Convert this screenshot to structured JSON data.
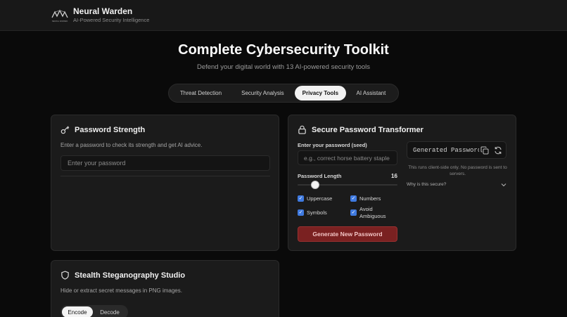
{
  "brand": {
    "name": "Neural Warden",
    "tagline": "AI-Powered Security Intelligence",
    "logo_text": "NEURAL WARDEN"
  },
  "hero": {
    "title": "Complete Cybersecurity Toolkit",
    "subtitle": "Defend your digital world with 13 AI-powered security tools"
  },
  "tabs": [
    {
      "label": "Threat Detection",
      "active": false
    },
    {
      "label": "Security Analysis",
      "active": false
    },
    {
      "label": "Privacy Tools",
      "active": true
    },
    {
      "label": "AI Assistant",
      "active": false
    }
  ],
  "password_strength": {
    "title": "Password Strength",
    "description": "Enter a password to check its strength and get AI advice.",
    "input_placeholder": "Enter your password",
    "icon": "key-icon"
  },
  "transformer": {
    "title": "Secure Password Transformer",
    "icon": "lock-icon",
    "seed_label": "Enter your password (seed)",
    "seed_placeholder": "e.g., correct horse battery staple",
    "length_label": "Password Length",
    "length_value": "16",
    "options": [
      {
        "label": "Uppercase",
        "checked": true
      },
      {
        "label": "Numbers",
        "checked": true
      },
      {
        "label": "Symbols",
        "checked": true
      },
      {
        "label": "Avoid Ambiguous",
        "checked": true
      }
    ],
    "generate_label": "Generate New Password",
    "generated_placeholder": "Generated Password",
    "note": "This runs client-side only. No password is sent to servers.",
    "why_label": "Why is this secure?"
  },
  "steganography": {
    "title": "Stealth Steganography Studio",
    "icon": "shield-icon",
    "description": "Hide or extract secret messages in PNG images.",
    "modes": [
      {
        "label": "Encode",
        "active": true
      },
      {
        "label": "Decode",
        "active": false
      }
    ]
  },
  "colors": {
    "background": "#0a0a0a",
    "card": "#1b1b1b",
    "accent_red": "#7a2121",
    "checkbox_blue": "#3f7ae0"
  }
}
